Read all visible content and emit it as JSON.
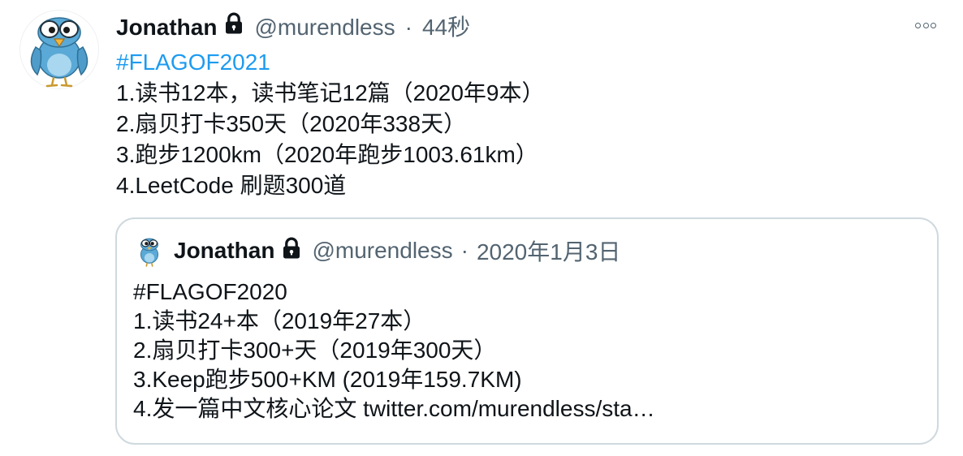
{
  "tweet": {
    "author_name": "Jonathan",
    "handle": "@murendless",
    "separator": "·",
    "time": "44秒",
    "hashtag": "#FLAGOF2021",
    "lines": [
      "1.读书12本，读书笔记12篇（2020年9本）",
      "2.扇贝打卡350天（2020年338天）",
      "3.跑步1200km（2020年跑步1003.61km）",
      "4.LeetCode 刷题300道"
    ]
  },
  "quoted": {
    "author_name": "Jonathan",
    "handle": "@murendless",
    "separator": "·",
    "date": "2020年1月3日",
    "first_line": "#FLAGOF2020",
    "lines": [
      "1.读书24+本（2019年27本）",
      "2.扇贝打卡300+天（2019年300天）",
      "3.Keep跑步500+KM (2019年159.7KM)"
    ],
    "last_line_text": "4.发一篇中文核心论文 ",
    "link_text": "twitter.com/murendless/sta…"
  },
  "colors": {
    "accent": "#1d9bf0",
    "muted": "#536471",
    "border": "#cfd9de",
    "text": "#0f1419"
  },
  "icons": {
    "lock": "lock-icon",
    "more": "more-icon"
  }
}
